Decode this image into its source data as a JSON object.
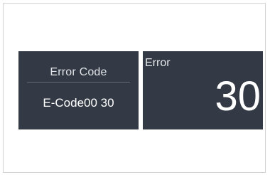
{
  "left_panel": {
    "title": "Error Code",
    "code": "E-Code00 30"
  },
  "right_panel": {
    "title": "Error",
    "value": "30"
  },
  "colors": {
    "panel_bg": "#343a45",
    "text": "#ffffff"
  }
}
